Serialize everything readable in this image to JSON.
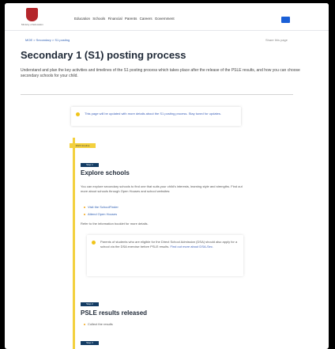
{
  "header": {
    "logo_caption": "Ministry of Education",
    "nav_items": [
      "Education",
      "Schools",
      "Financial",
      "Parents",
      "Careers",
      "Government"
    ],
    "search_icon": "search-icon"
  },
  "breadcrumb": "MOE > Secondary > S1 posting",
  "share_label": "Share this page",
  "page": {
    "title": "Secondary 1 (S1) posting process",
    "lead": "Understand and plan the key activities and timelines of the S1 posting process which takes place after the release of the PSLE results, and how you can choose secondary schools for your child."
  },
  "notice": {
    "text": "This page will be updated with more details about the S1 posting process. Stay tuned for updates."
  },
  "timeline": {
    "tag": "2024 timeline",
    "steps": [
      {
        "label": "Step 1",
        "title": "Explore schools",
        "body": "You can explore secondary schools to find one that suits your child's interests, learning style and strengths. Find out more about schools through Open Houses and school websites:",
        "links": [
          "Visit the SchoolFinder",
          "Attend Open Houses"
        ],
        "extra": "Refer to the information booklet for more details.",
        "note_plain": "Parents of students who are eligible for the Direct School Admission (DSA) should also apply for a school via the DSA exercise before PSLE results.",
        "note_link": "Find out more about DSA-Sec."
      },
      {
        "label": "Step 2",
        "title": "PSLE results released",
        "bullets": [
          "Collect the results"
        ]
      },
      {
        "label": "Step 3"
      }
    ]
  }
}
